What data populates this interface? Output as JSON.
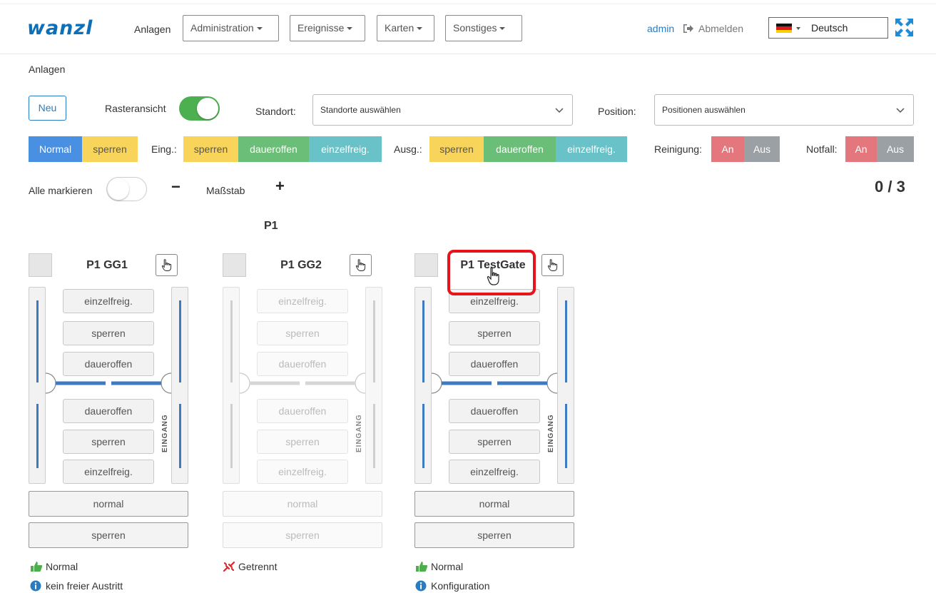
{
  "navbar": {
    "logo": "wanzl",
    "anlagen_link": "Anlagen",
    "menus": [
      {
        "label": "Administration"
      },
      {
        "label": "Ereignisse"
      },
      {
        "label": "Karten"
      },
      {
        "label": "Sonstiges"
      }
    ],
    "user": "admin",
    "logout_label": "Abmelden",
    "language": "Deutsch"
  },
  "breadcrumb": "Anlagen",
  "toolbar": {
    "new_button": "Neu",
    "grid_view_label": "Rasteransicht",
    "grid_view_on": true,
    "location_label": "Standort:",
    "location_placeholder": "Standorte auswählen",
    "position_label": "Position:",
    "position_placeholder": "Positionen auswählen"
  },
  "mode_bar": {
    "normal": "Normal",
    "sperren": "sperren",
    "entrance_label": "Eing.:",
    "entrance": [
      "sperren",
      "daueroffen",
      "einzelfreig."
    ],
    "exit_label": "Ausg.:",
    "exit": [
      "sperren",
      "daueroffen",
      "einzelfreig."
    ],
    "cleaning_label": "Reinigung:",
    "emergency_label": "Notfall:",
    "on": "An",
    "off": "Aus"
  },
  "select_row": {
    "select_all_label": "Alle markieren",
    "select_all_on": false,
    "minus": "−",
    "scale_label": "Maßstab",
    "plus": "+",
    "counter": "0 / 3"
  },
  "group_title": "P1",
  "gates": [
    {
      "name": "P1 GG1",
      "buttons_top": [
        "einzelfreig.",
        "sperren",
        "daueroffen"
      ],
      "buttons_bottom": [
        "daueroffen",
        "sperren",
        "einzelfreig."
      ],
      "side_label": "EINGANG",
      "wide_buttons": [
        "normal",
        "sperren"
      ],
      "status": "Normal",
      "status_icon": "thumbs-up-icon",
      "info": "kein freier Austritt",
      "enabled": true
    },
    {
      "name": "P1 GG2",
      "buttons_top": [
        "einzelfreig.",
        "sperren",
        "daueroffen"
      ],
      "buttons_bottom": [
        "daueroffen",
        "sperren",
        "einzelfreig."
      ],
      "side_label": "EINGANG",
      "wide_buttons": [
        "normal",
        "sperren"
      ],
      "status": "Getrennt",
      "status_icon": "disconnected-icon",
      "info": "",
      "enabled": false
    },
    {
      "name": "P1 TestGate",
      "buttons_top": [
        "einzelfreig.",
        "sperren",
        "daueroffen"
      ],
      "buttons_bottom": [
        "daueroffen",
        "sperren",
        "einzelfreig."
      ],
      "side_label": "EINGANG",
      "wide_buttons": [
        "normal",
        "sperren"
      ],
      "status": "Normal",
      "status_icon": "thumbs-up-icon",
      "info": "Konfiguration",
      "enabled": true
    }
  ],
  "colors": {
    "brand_blue": "#0c6fb8",
    "normal_blue": "#4a90e2",
    "yellow": "#f8d55a",
    "green": "#6bbe77",
    "teal": "#68c2c8",
    "red": "#e3777d",
    "gray": "#9aa0a4",
    "rail_blue": "#3d7ac0",
    "highlight_red": "#e8141c"
  }
}
